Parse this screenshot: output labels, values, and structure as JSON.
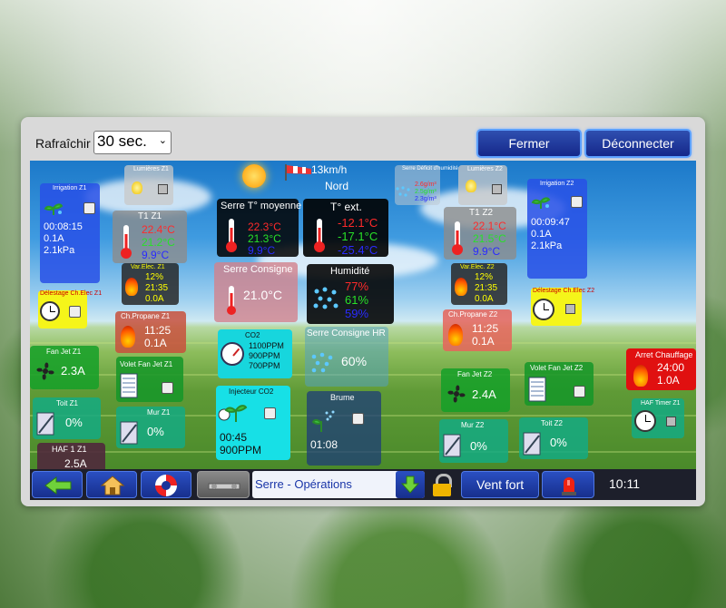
{
  "header": {
    "refresh_label": "Rafraîchir",
    "refresh_value": "30 sec.",
    "close_label": "Fermer",
    "disconnect_label": "Déconnecter"
  },
  "weather": {
    "wind_speed": "13km/h",
    "wind_dir": "Nord"
  },
  "z1": {
    "irrigation": {
      "title": "Irrigation Z1",
      "time": "00:08:15",
      "current": "0.1A",
      "pressure": "2.1kPa"
    },
    "lumieres": {
      "title": "Lumières Z1"
    },
    "t1": {
      "title": "T1 Z1",
      "v1": "22.4°C",
      "v2": "21.2°C",
      "v3": "9.9°C"
    },
    "var_elec": {
      "title": "Var.Elec. Z1",
      "pct": "12%",
      "time": "21:35",
      "current": "0.0A"
    },
    "delestage": {
      "title": "Délestage Ch.Elec Z1"
    },
    "propane": {
      "title": "Ch.Propane Z1",
      "time": "11:25",
      "current": "0.1A"
    },
    "fan_jet": {
      "title": "Fan Jet Z1",
      "current": "2.3A"
    },
    "volet": {
      "title": "Volet Fan Jet Z1"
    },
    "toit": {
      "title": "Toit Z1",
      "pct": "0%"
    },
    "mur": {
      "title": "Mur Z1",
      "pct": "0%"
    },
    "haf": {
      "title": "HAF 1 Z1",
      "value": "2.5A"
    }
  },
  "center": {
    "moyenne": {
      "title": "Serre T° moyenne",
      "v1": "22.3°C",
      "v2": "21.3°C",
      "v3": "9.9°C"
    },
    "ext": {
      "title": "T° ext.",
      "v1": "-12.1°C",
      "v2": "-17.1°C",
      "v3": "-25.4°C"
    },
    "consigne": {
      "title": "Serre Consigne",
      "value": "21.0°C"
    },
    "humidite": {
      "title": "Humidité",
      "v1": "77%",
      "v2": "61%",
      "v3": "59%"
    },
    "co2": {
      "title": "CO2",
      "v1": "1100PPM",
      "v2": "900PPM",
      "v3": "700PPM"
    },
    "consigne_hr": {
      "title": "Serre Consigne HR",
      "value": "60%"
    },
    "injecteur": {
      "title": "Injecteur CO2",
      "time": "00:45",
      "ppm": "900PPM"
    },
    "brume": {
      "title": "Brume",
      "time": "01:08"
    },
    "deficit": {
      "title": "Serre Déficit d'humidité",
      "v1": "2.6g/m³",
      "v2": "2.5g/m³",
      "v3": "2.3g/m³"
    }
  },
  "z2": {
    "lumieres": {
      "title": "Lumières Z2"
    },
    "irrigation": {
      "title": "Irrigation Z2",
      "time": "00:09:47",
      "current": "0.1A",
      "pressure": "2.1kPa"
    },
    "t1": {
      "title": "T1 Z2",
      "v1": "22.1°C",
      "v2": "21.5°C",
      "v3": "9.9°C"
    },
    "var_elec": {
      "title": "Var.Elec. Z2",
      "pct": "12%",
      "time": "21:35",
      "current": "0.0A"
    },
    "delestage": {
      "title": "Délestage Ch.Elec Z2"
    },
    "propane": {
      "title": "Ch.Propane Z2",
      "time": "11:25",
      "current": "0.1A"
    },
    "arret": {
      "title": "Arret Chauffage",
      "time": "24:00",
      "current": "1.0A"
    },
    "fan_jet": {
      "title": "Fan Jet Z2",
      "current": "2.4A"
    },
    "volet": {
      "title": "Volet Fan Jet Z2"
    },
    "haf": {
      "title": "HAF Timer Z1"
    },
    "mur": {
      "title": "Mur Z2",
      "pct": "0%"
    },
    "toit": {
      "title": "Toit Z2",
      "pct": "0%"
    }
  },
  "footer": {
    "page_label": "Serre - Opérations",
    "vent_label": "Vent fort",
    "time": "10:11"
  },
  "colors": {
    "t_red": "#ff2a2a",
    "t_green": "#28e028",
    "t_blue": "#2a2aff",
    "accent_button": "#1f3aa0"
  }
}
